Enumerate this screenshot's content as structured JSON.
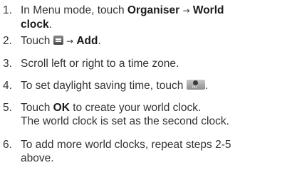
{
  "steps": [
    {
      "num": "1.",
      "line1_prefix": "In Menu mode, touch ",
      "b1": "Organiser",
      "arrow": "→",
      "b2": "World",
      "line2_b": "clock",
      "line2_suffix": "."
    },
    {
      "num": "2.",
      "prefix": "Touch ",
      "icon": "menu-icon",
      "arrow": "→",
      "b1": "Add",
      "suffix": "."
    },
    {
      "num": "3.",
      "text": "Scroll left or right to a time zone."
    },
    {
      "num": "4.",
      "prefix": "To set daylight saving time, touch ",
      "icon": "daylight-saving-icon",
      "icon_text": "OFF",
      "suffix": "."
    },
    {
      "num": "5.",
      "prefix": "Touch ",
      "b1": "OK",
      "suffix": " to create your world clock.",
      "line2": "The world clock is set as the second clock."
    },
    {
      "num": "6.",
      "line1": "To add more world clocks, repeat steps 2-5",
      "line2": "above."
    }
  ]
}
